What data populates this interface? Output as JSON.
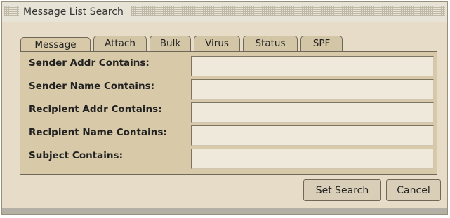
{
  "window": {
    "title": "Message List Search"
  },
  "tabs": [
    {
      "label": "Message",
      "active": true
    },
    {
      "label": "Attach",
      "active": false
    },
    {
      "label": "Bulk",
      "active": false
    },
    {
      "label": "Virus",
      "active": false
    },
    {
      "label": "Status",
      "active": false
    },
    {
      "label": "SPF",
      "active": false
    }
  ],
  "fields": [
    {
      "label": "Sender Addr Contains:",
      "value": ""
    },
    {
      "label": "Sender Name Contains:",
      "value": ""
    },
    {
      "label": "Recipient Addr Contains:",
      "value": ""
    },
    {
      "label": "Recipient Name Contains:",
      "value": ""
    },
    {
      "label": "Subject Contains:",
      "value": ""
    }
  ],
  "buttons": {
    "set_search": "Set Search",
    "cancel": "Cancel"
  },
  "colors": {
    "dialog_bg": "#e6dcc7",
    "panel_bg": "#d8caa8",
    "border": "#6f6757"
  }
}
